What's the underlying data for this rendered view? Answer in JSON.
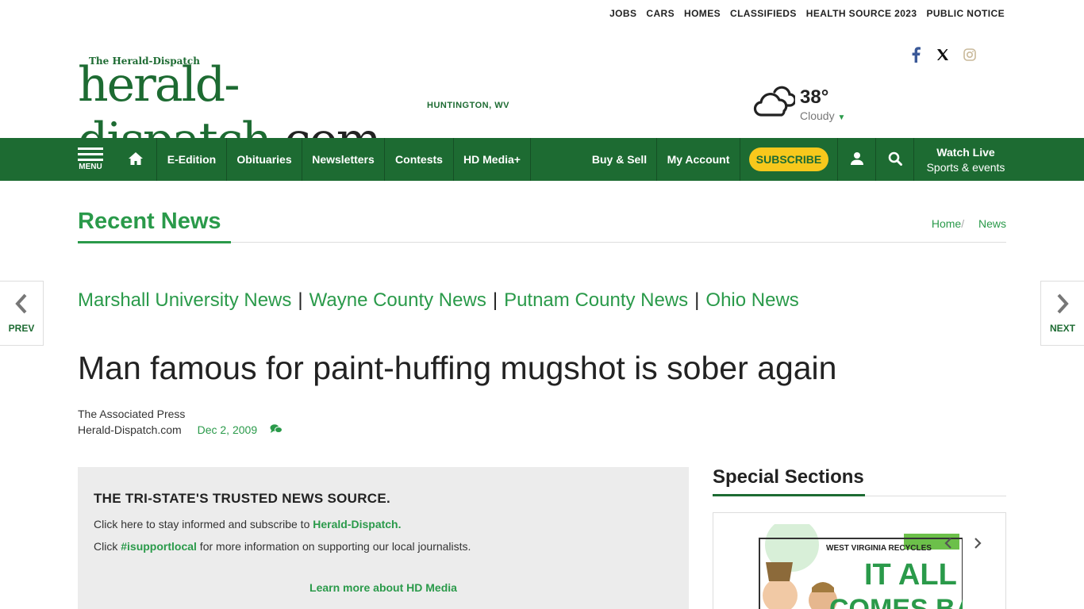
{
  "top_links": [
    "JOBS",
    "CARS",
    "HOMES",
    "CLASSIFIEDS",
    "HEALTH SOURCE 2023",
    "PUBLIC NOTICE"
  ],
  "logo": {
    "paper_name": "The Herald-Dispatch",
    "site": "herald-dispatch",
    "tld": ".com",
    "location": "HUNTINGTON, WV"
  },
  "social": [
    "facebook-icon",
    "x-icon",
    "instagram-icon"
  ],
  "weather": {
    "temp": "38°",
    "condition": "Cloudy",
    "icon": "cloud-icon"
  },
  "nav": {
    "menu_label": "MENU",
    "items": [
      "E-Edition",
      "Obituaries",
      "Newsletters",
      "Contests",
      "HD Media+"
    ],
    "right_items": [
      "Buy & Sell",
      "My Account"
    ],
    "subscribe": "SUBSCRIBE",
    "watch_live": "Watch Live",
    "watch_sub": "Sports & events",
    "colors": {
      "nav_bg": "#1d6b32",
      "subscribe_bg": "#f7c81c",
      "accent": "#2a9a4a"
    }
  },
  "section_header": {
    "title": "Recent News"
  },
  "breadcrumb": {
    "home": "Home",
    "sep": "/",
    "current": "News"
  },
  "pager": {
    "prev": "PREV",
    "next": "NEXT"
  },
  "news_sections": [
    "Marshall University News",
    "Wayne County News",
    "Putnam County News",
    "Ohio News"
  ],
  "article": {
    "headline": "Man famous for paint-huffing mugshot is sober again",
    "author": "The Associated Press",
    "source": "Herald-Dispatch.com",
    "date": "Dec 2, 2009"
  },
  "promo": {
    "heading": "THE TRI-STATE'S TRUSTED NEWS SOURCE.",
    "line1_pre": "Click here to stay informed and subscribe to ",
    "line1_link": "Herald-Dispatch.",
    "line2_pre": "Click ",
    "line2_link": "#isupportlocal",
    "line2_post": " for more information on supporting our local journalists.",
    "more": "Learn more about HD Media"
  },
  "special_sections": {
    "title": "Special Sections",
    "ad_top": "WEST VIRGINIA RECYCLES",
    "ad_headline": "IT ALL",
    "ad_headline2": "COMES BACK"
  }
}
